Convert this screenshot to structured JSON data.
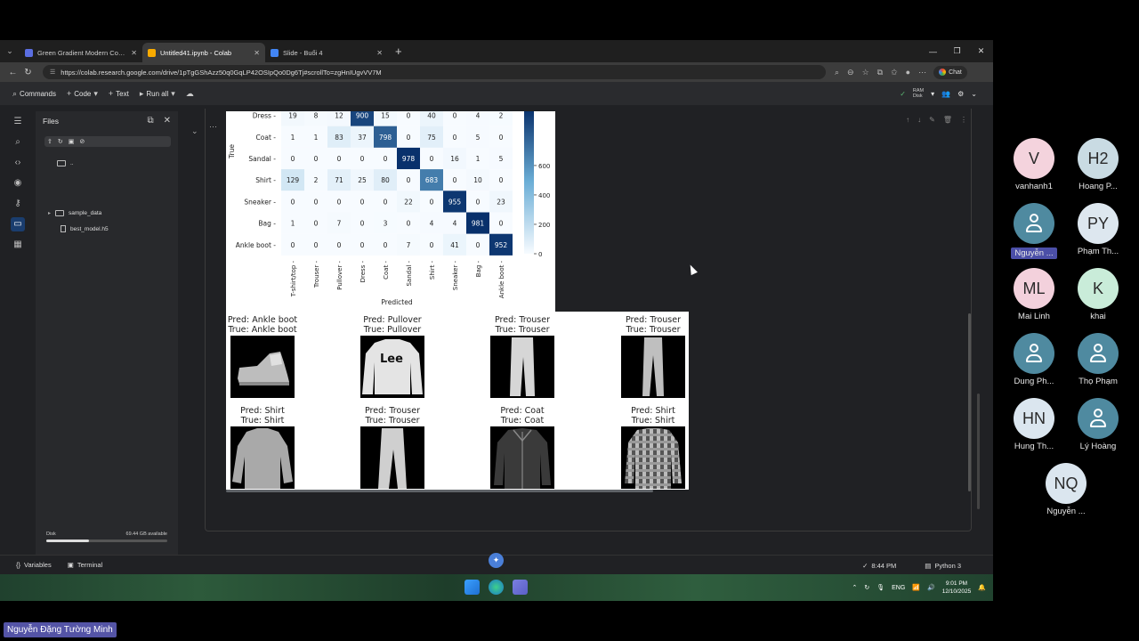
{
  "browser": {
    "tabs": [
      {
        "label": "Green Gradient Modern Computer",
        "color": "#5b6ee1",
        "active": false
      },
      {
        "label": "Untitled41.ipynb - Colab",
        "color": "#f9ab00",
        "active": true
      },
      {
        "label": "Slide - Buổi 4",
        "color": "#4285f4",
        "active": false
      }
    ],
    "url": "https://colab.research.google.com/drive/1pTgGShAzz50q0GqLP42OSIpQo0Dg6Tj#scrollTo=zgHnIUgvVV7M",
    "chat_label": "Chat"
  },
  "toolbar": {
    "commands": "Commands",
    "code": "Code",
    "text": "Text",
    "run_all": "Run all",
    "ram": "RAM",
    "disk": "Disk"
  },
  "files": {
    "title": "Files",
    "items": [
      {
        "name": "..",
        "type": "folder"
      },
      {
        "name": "sample_data",
        "type": "folder"
      },
      {
        "name": "best_model.h5",
        "type": "file"
      }
    ],
    "disk_label": "Disk",
    "disk_available": "69.44 GB available",
    "disk_used_fraction": 0.35
  },
  "chart_data": {
    "type": "heatmap",
    "ylabel": "True",
    "xlabel": "Predicted",
    "x_categories": [
      "T-shirt/top",
      "Trouser",
      "Pullover",
      "Dress",
      "Coat",
      "Sandal",
      "Shirt",
      "Sneaker",
      "Bag",
      "Ankle boot"
    ],
    "y_categories_visible": [
      "Dress",
      "Coat",
      "Sandal",
      "Shirt",
      "Sneaker",
      "Bag",
      "Ankle boot"
    ],
    "values": [
      [
        19,
        8,
        12,
        900,
        15,
        0,
        40,
        0,
        4,
        2
      ],
      [
        1,
        1,
        83,
        37,
        798,
        0,
        75,
        0,
        5,
        0
      ],
      [
        0,
        0,
        0,
        0,
        0,
        978,
        0,
        16,
        1,
        5
      ],
      [
        129,
        2,
        71,
        25,
        80,
        0,
        683,
        0,
        10,
        0
      ],
      [
        0,
        0,
        0,
        0,
        0,
        22,
        0,
        955,
        0,
        23
      ],
      [
        1,
        0,
        7,
        0,
        3,
        0,
        4,
        4,
        981,
        0
      ],
      [
        0,
        0,
        0,
        0,
        0,
        7,
        0,
        41,
        0,
        952
      ]
    ],
    "colorbar_ticks": [
      "600",
      "400",
      "200",
      "0"
    ],
    "colorbar_values": [
      600,
      400,
      200,
      0
    ],
    "vmax": 981,
    "colormap": "Blues"
  },
  "predictions": [
    {
      "pred": "Pred: Ankle boot",
      "true": "True: Ankle boot",
      "item": "ankle-boot"
    },
    {
      "pred": "Pred: Pullover",
      "true": "True: Pullover",
      "item": "pullover"
    },
    {
      "pred": "Pred: Trouser",
      "true": "True: Trouser",
      "item": "trouser"
    },
    {
      "pred": "Pred: Trouser",
      "true": "True: Trouser",
      "item": "trouser"
    },
    {
      "pred": "Pred: Shirt",
      "true": "True: Shirt",
      "item": "shirt"
    },
    {
      "pred": "Pred: Trouser",
      "true": "True: Trouser",
      "item": "trouser"
    },
    {
      "pred": "Pred: Coat",
      "true": "True: Coat",
      "item": "coat"
    },
    {
      "pred": "Pred: Shirt",
      "true": "True: Shirt",
      "item": "shirt"
    }
  ],
  "pullover_logo_text": "Lee",
  "statusbar": {
    "variables": "Variables",
    "terminal": "Terminal",
    "time": "8:44 PM",
    "runtime": "Python 3"
  },
  "taskbar": {
    "lang": "ENG",
    "time": "9:01 PM",
    "date": "12/10/2025"
  },
  "participants": [
    {
      "initials": "V",
      "name": "vanhanh1",
      "color": "#f4d3dd",
      "icon": ""
    },
    {
      "initials": "H2",
      "name": "Hoang P...",
      "color": "#c9dbe3",
      "icon": ""
    },
    {
      "initials": "",
      "name": "Nguyễn ...",
      "color": "#4f8aa0",
      "icon": "person-icon",
      "highlight": true
    },
    {
      "initials": "PY",
      "name": "Phạm Th...",
      "color": "#dde7ef",
      "icon": ""
    },
    {
      "initials": "ML",
      "name": "Mai Linh",
      "color": "#f3d1dc",
      "icon": ""
    },
    {
      "initials": "K",
      "name": "khai",
      "color": "#c9ecd9",
      "icon": ""
    },
    {
      "initials": "",
      "name": "Dung Ph...",
      "color": "#4f8aa0",
      "icon": "person-icon"
    },
    {
      "initials": "",
      "name": "Thọ Phạm",
      "color": "#4f8aa0",
      "icon": "person-icon"
    },
    {
      "initials": "HN",
      "name": "Hung Th...",
      "color": "#dbe6ef",
      "icon": ""
    },
    {
      "initials": "",
      "name": "Lý Hoàng",
      "color": "#4f8aa0",
      "icon": "person-icon"
    },
    {
      "initials": "NQ",
      "name": "Nguyễn ...",
      "color": "#dbe6ef",
      "icon": ""
    }
  ],
  "speaker": "Nguyễn Đặng Tường Minh"
}
